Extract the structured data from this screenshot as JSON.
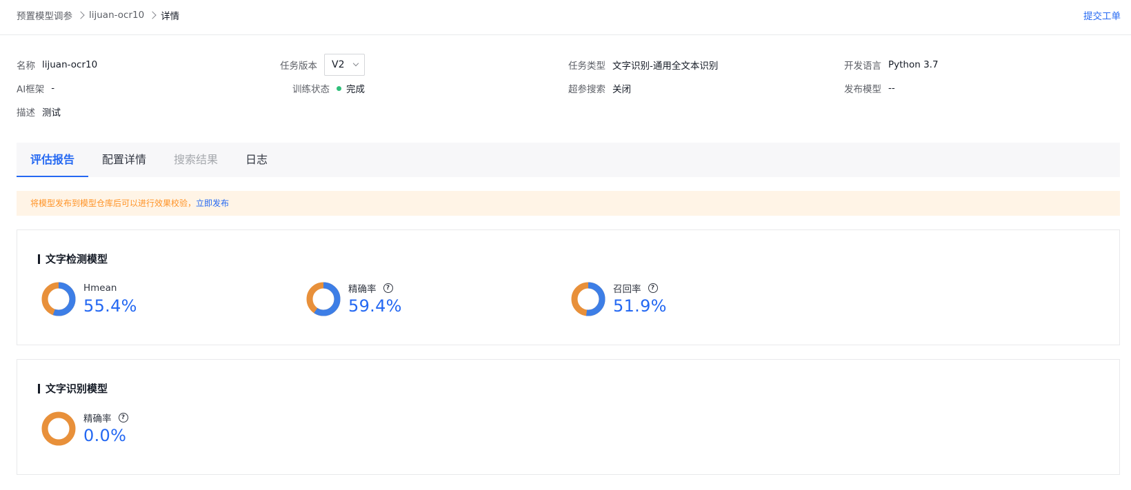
{
  "breadcrumb": {
    "items": [
      "预置模型调参",
      "lijuan-ocr10",
      "详情"
    ]
  },
  "header": {
    "submit_ticket": "提交工单"
  },
  "info": {
    "name": {
      "label": "名称",
      "value": "lijuan-ocr10"
    },
    "version": {
      "label": "任务版本",
      "value": "V2"
    },
    "task_type": {
      "label": "任务类型",
      "value": "文字识别-通用全文本识别"
    },
    "dev_lang": {
      "label": "开发语言",
      "value": "Python 3.7"
    },
    "ai_framework": {
      "label": "AI框架",
      "value": "-"
    },
    "train_status": {
      "label": "训练状态",
      "value": "完成"
    },
    "hyperparam_search": {
      "label": "超参搜索",
      "value": "关闭"
    },
    "publish_model": {
      "label": "发布模型",
      "value": "--"
    },
    "description": {
      "label": "描述",
      "value": "测试"
    }
  },
  "tabs": [
    {
      "label": "评估报告",
      "state": "active"
    },
    {
      "label": "配置详情",
      "state": "normal"
    },
    {
      "label": "搜索结果",
      "state": "disabled"
    },
    {
      "label": "日志",
      "state": "normal"
    }
  ],
  "notice": {
    "text": "将模型发布到模型仓库后可以进行效果校验，",
    "link": "立即发布"
  },
  "sections": [
    {
      "title": "文字检测模型",
      "metrics": [
        {
          "name": "Hmean",
          "value": "55.4%",
          "fraction": 0.554,
          "help": false
        },
        {
          "name": "精确率",
          "value": "59.4%",
          "fraction": 0.594,
          "help": true
        },
        {
          "name": "召回率",
          "value": "51.9%",
          "fraction": 0.519,
          "help": true
        }
      ]
    },
    {
      "title": "文字识别模型",
      "metrics": [
        {
          "name": "精确率",
          "value": "0.0%",
          "fraction": 0.0,
          "help": true
        }
      ]
    }
  ],
  "colors": {
    "accent": "#2468f2",
    "donut_fill": "#3d7ee6",
    "donut_rest": "#e8903a",
    "success": "#30bf7a",
    "notice_bg": "#fff4e6",
    "notice_text": "#ff9326"
  }
}
